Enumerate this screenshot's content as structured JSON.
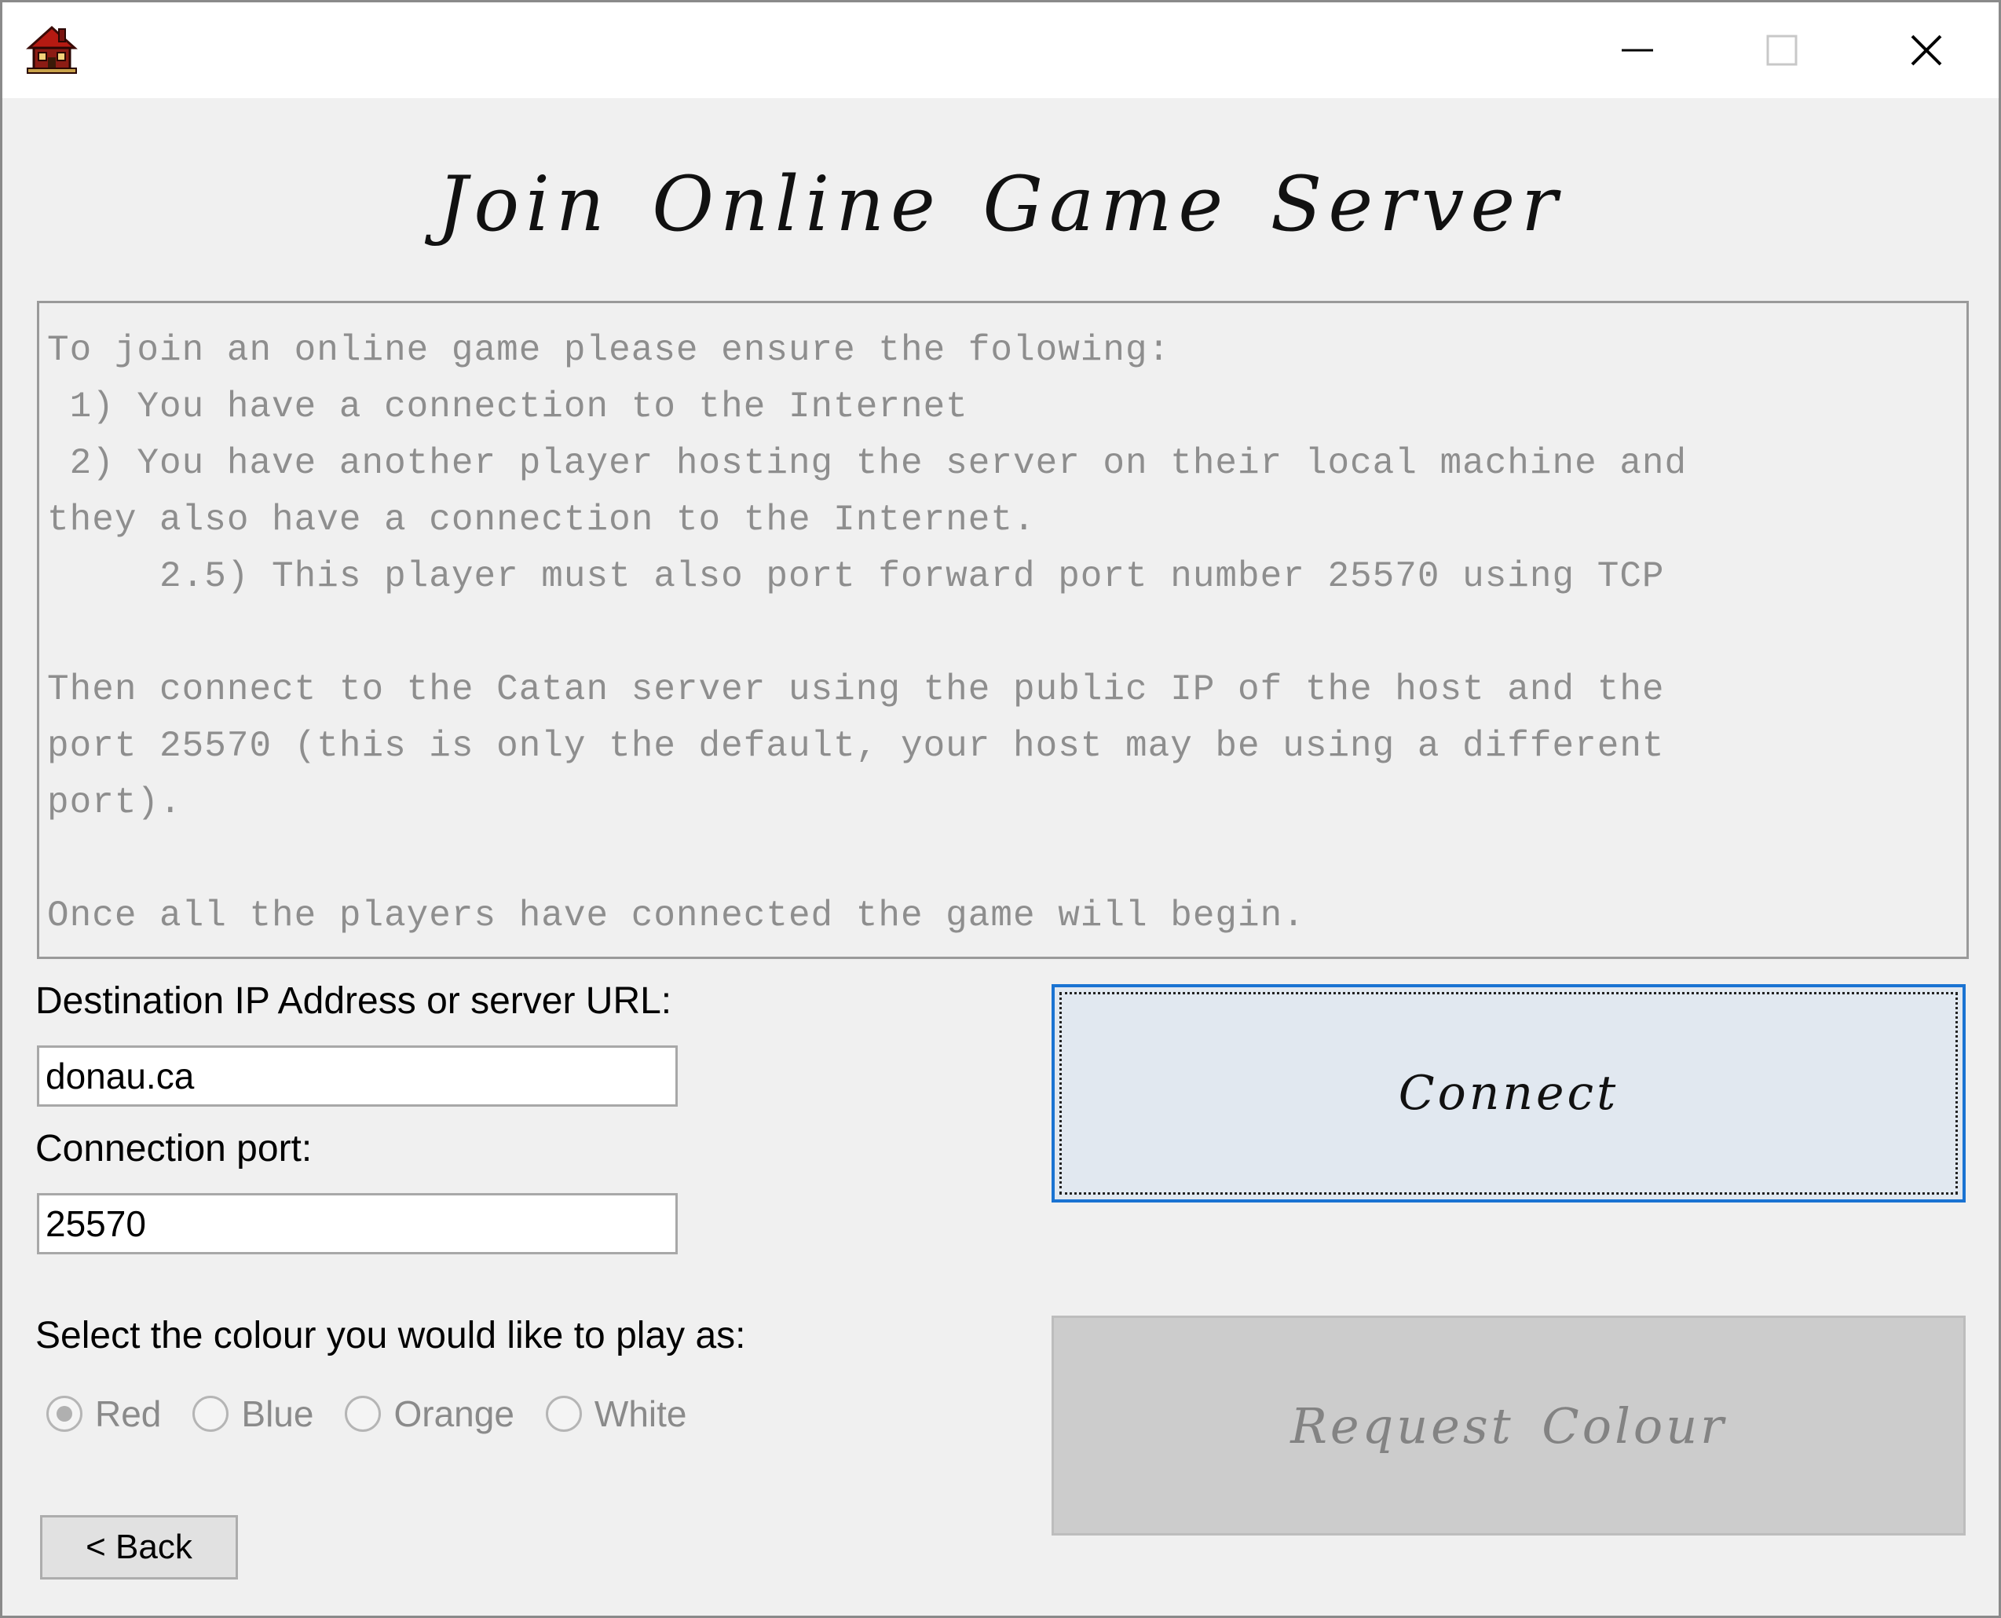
{
  "window": {
    "title": ""
  },
  "title_bar": {
    "app_icon": "catan-house-icon",
    "minimize_icon": "minimize-icon",
    "maximize_icon": "maximize-icon",
    "close_icon": "close-icon"
  },
  "page": {
    "title": "Join Online Game Server",
    "instructions": "To join an online game please ensure the folowing:\n 1) You have a connection to the Internet\n 2) You have another player hosting the server on their local machine and\nthey also have a connection to the Internet.\n     2.5) This player must also port forward port number 25570 using TCP\n\nThen connect to the Catan server using the public IP of the host and the\nport 25570 (this is only the default, your host may be using a different\nport).\n\nOnce all the players have connected the game will begin."
  },
  "form": {
    "ip_label": "Destination IP Address or server URL:",
    "ip_value": "donau.ca",
    "port_label": "Connection port:",
    "port_value": "25570",
    "colour_label": "Select the colour you would like to play as:",
    "colours": [
      {
        "label": "Red",
        "selected": true,
        "enabled": false
      },
      {
        "label": "Blue",
        "selected": false,
        "enabled": false
      },
      {
        "label": "Orange",
        "selected": false,
        "enabled": false
      },
      {
        "label": "White",
        "selected": false,
        "enabled": false
      }
    ]
  },
  "buttons": {
    "connect_label": "Connect",
    "request_colour_label": "Request Colour",
    "back_label": "< Back"
  },
  "colors": {
    "focus_accent": "#1a73d2",
    "connect_bg": "#e1e8f0",
    "disabled_bg": "#cccccc",
    "window_bg": "#f0f0f0"
  }
}
